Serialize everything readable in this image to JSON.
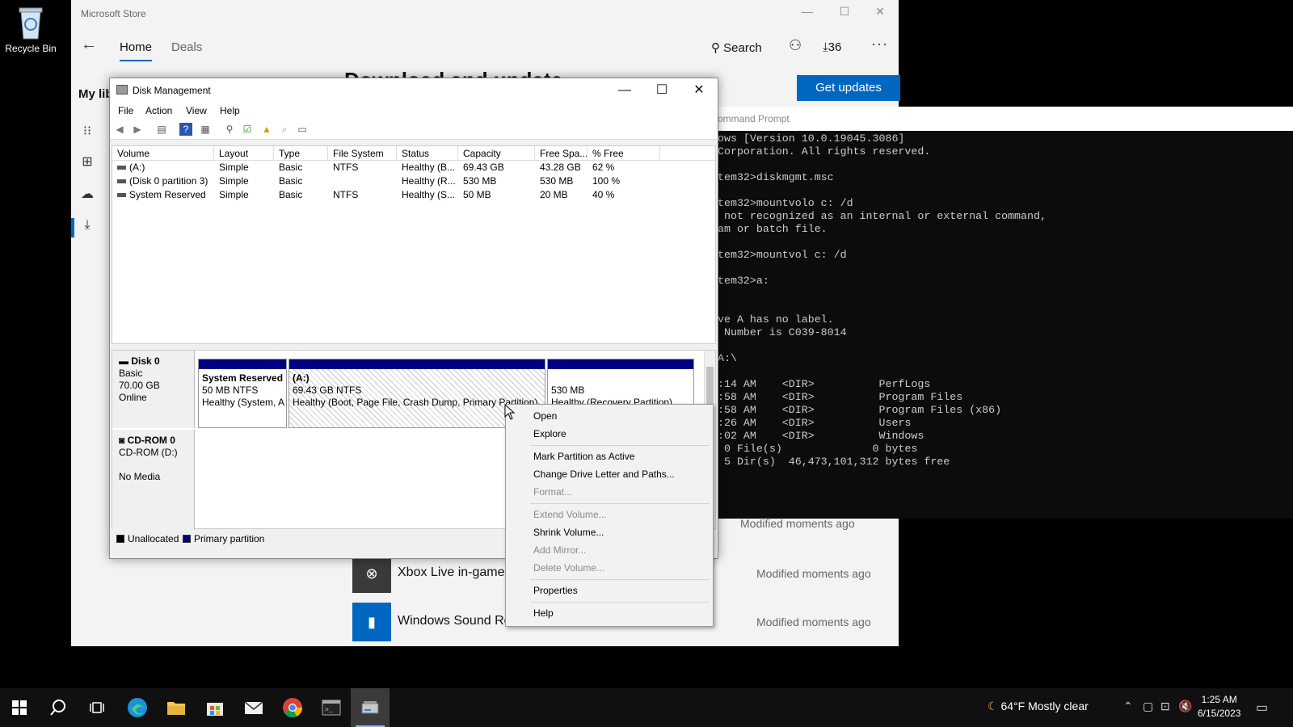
{
  "desktop": {
    "recycle_bin_label": "Recycle Bin"
  },
  "store": {
    "window_title": "Microsoft Store",
    "tabs": {
      "home": "Home",
      "deals": "Deals"
    },
    "search_label": "Search",
    "download_count": "36",
    "my_library_fragment": "My lib",
    "heading_fragment": "Download and update",
    "get_updates_label": "Get updates",
    "library_rows": [
      {
        "name": "Xbox Live in-game...",
        "modified": "Modified moments ago",
        "thumb_color": "#3a3a3a"
      },
      {
        "name": "Windows Sound Re...",
        "modified": "Modified moments ago",
        "thumb_color": "#0067c0"
      }
    ],
    "partial_modified": "Modified moments ago"
  },
  "cmd": {
    "title_fragment": "ommand Prompt",
    "lines": [
      "ows [Version 10.0.19045.3086]",
      "Corporation. All rights reserved.",
      "",
      "tem32>diskmgmt.msc",
      "",
      "tem32>mountvolo c: /d",
      " not recognized as an internal or external command,",
      "am or batch file.",
      "",
      "tem32>mountvol c: /d",
      "",
      "tem32>a:",
      "",
      "",
      "ve A has no label.",
      " Number is C039-8014",
      "",
      "A:\\",
      "",
      ":14 AM    <DIR>          PerfLogs",
      ":58 AM    <DIR>          Program Files",
      ":58 AM    <DIR>          Program Files (x86)",
      ":26 AM    <DIR>          Users",
      ":02 AM    <DIR>          Windows",
      " 0 File(s)              0 bytes",
      " 5 Dir(s)  46,473,101,312 bytes free"
    ]
  },
  "disk_mgmt": {
    "window_title": "Disk Management",
    "menu": [
      "File",
      "Action",
      "View",
      "Help"
    ],
    "columns": [
      "Volume",
      "Layout",
      "Type",
      "File System",
      "Status",
      "Capacity",
      "Free Spa...",
      "% Free"
    ],
    "volumes": [
      [
        "(A:)",
        "Simple",
        "Basic",
        "NTFS",
        "Healthy (B...",
        "69.43 GB",
        "43.28 GB",
        "62 %"
      ],
      [
        "(Disk 0 partition 3)",
        "Simple",
        "Basic",
        "",
        "Healthy (R...",
        "530 MB",
        "530 MB",
        "100 %"
      ],
      [
        "System Reserved",
        "Simple",
        "Basic",
        "NTFS",
        "Healthy (S...",
        "50 MB",
        "20 MB",
        "40 %"
      ]
    ],
    "disk0": {
      "name": "Disk 0",
      "type": "Basic",
      "size": "70.00 GB",
      "status": "Online",
      "partitions": [
        {
          "title": "System Reserved",
          "line1": "50 MB NTFS",
          "line2": "Healthy (System, A"
        },
        {
          "title": "(A:)",
          "line1": "69.43 GB NTFS",
          "line2": "Healthy (Boot, Page File, Crash Dump, Primary Partition)"
        },
        {
          "title": "",
          "line1": "530 MB",
          "line2": "Healthy (Recovery Partition)"
        }
      ]
    },
    "cdrom": {
      "name": "CD-ROM 0",
      "type": "CD-ROM (D:)",
      "status": "No Media"
    },
    "legend": {
      "unallocated": "Unallocated",
      "primary": "Primary partition"
    },
    "colors": {
      "primary_partition": "#000080",
      "unallocated": "#000000"
    }
  },
  "context_menu": {
    "items": [
      {
        "label": "Open",
        "enabled": true
      },
      {
        "label": "Explore",
        "enabled": true
      },
      {
        "label": "Mark Partition as Active",
        "enabled": true
      },
      {
        "label": "Change Drive Letter and Paths...",
        "enabled": true
      },
      {
        "label": "Format...",
        "enabled": false
      },
      {
        "label": "Extend Volume...",
        "enabled": false
      },
      {
        "label": "Shrink Volume...",
        "enabled": true
      },
      {
        "label": "Add Mirror...",
        "enabled": false
      },
      {
        "label": "Delete Volume...",
        "enabled": false
      },
      {
        "label": "Properties",
        "enabled": true
      },
      {
        "label": "Help",
        "enabled": true
      }
    ]
  },
  "taskbar": {
    "weather": {
      "temp": "64°F",
      "condition": "Mostly clear"
    },
    "clock": {
      "time": "1:25 AM",
      "date": "6/15/2023"
    }
  }
}
